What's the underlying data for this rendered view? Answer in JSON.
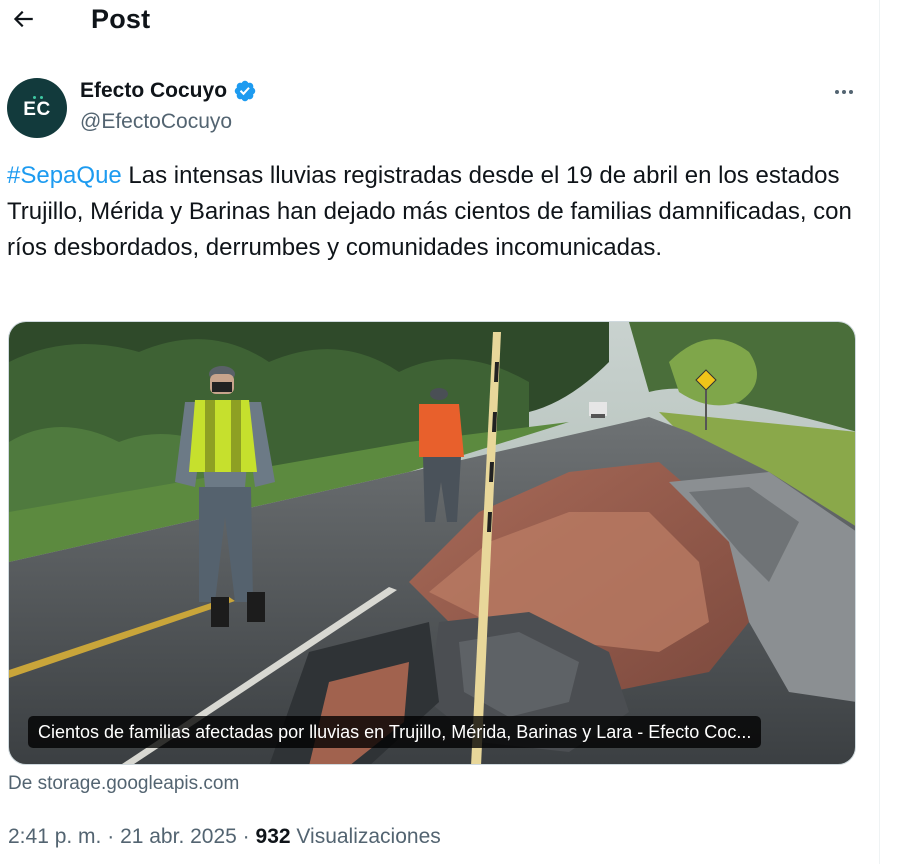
{
  "header": {
    "title": "Post"
  },
  "author": {
    "avatar_text": "EC",
    "name": "Efecto Cocuyo",
    "handle": "@EfectoCocuyo"
  },
  "tweet": {
    "hashtag": "#SepaQue",
    "body": " Las intensas lluvias registradas desde el 19 de abril en los estados Trujillo, Mérida y Barinas han dejado más cientos de familias damnificadas, con ríos desbordados, derrumbes y comunidades incomunicadas."
  },
  "media": {
    "caption": "Cientos de familias afectadas por lluvias en Trujillo, Mérida, Barinas y Lara - Efecto Coc..."
  },
  "source": "De storage.googleapis.com",
  "meta": {
    "time": "2:41 p. m.",
    "separator1": " · ",
    "date": "21 abr. 2025",
    "separator2": " · ",
    "views": "932",
    "views_label": " Visualizaciones"
  },
  "colors": {
    "accent": "#1d9bf0",
    "secondary_text": "#536471",
    "avatar_bg": "#123a3c"
  },
  "icons": {
    "back": "arrow-left-icon",
    "verified": "verified-badge-icon",
    "more": "more-horizontal-icon"
  }
}
